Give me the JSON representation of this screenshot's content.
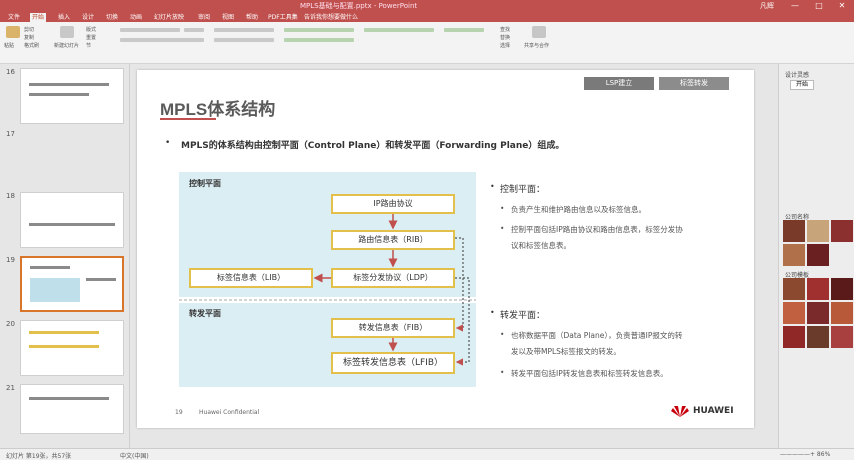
{
  "window": {
    "title": "MPLS基础与配置.pptx - PowerPoint",
    "user": "凡辉",
    "min": "—",
    "max": "□",
    "close": "✕"
  },
  "tabs": [
    "文件",
    "开始",
    "插入",
    "设计",
    "切换",
    "动画",
    "幻灯片放映",
    "审阅",
    "视图",
    "帮助",
    "PDF工具集",
    "告诉我你想要做什么"
  ],
  "ribbon": {
    "paste": "粘贴",
    "new_slide": "新建幻灯片",
    "find": "查找",
    "replace": "替换",
    "select": "选择",
    "present": "共享与合作",
    "cut": "剪切",
    "copy": "复制",
    "format": "格式刷",
    "layout": "版式",
    "reset": "重置",
    "section": "节"
  },
  "slides": [
    {
      "num": "16"
    },
    {
      "num": "17"
    },
    {
      "num": "18"
    },
    {
      "num": "19"
    },
    {
      "num": "20"
    },
    {
      "num": "21"
    }
  ],
  "slide": {
    "title": "MPLS体系结构",
    "nav_tabs": [
      "LSP建立",
      "标签转发"
    ],
    "bullet": "MPLS的体系结构由控制平面（Control Plane）和转发平面（Forwarding Plane）组成。",
    "diagram": {
      "control_label": "控制平面",
      "forward_label": "转发平面",
      "ip_routing": "IP路由协议",
      "rib": "路由信息表（RIB）",
      "ldp": "标签分发协议（LDP）",
      "lib": "标签信息表（LIB）",
      "fib": "转发信息表（FIB）",
      "lfib": "标签转发信息表（LFIB）"
    },
    "right": {
      "control_head": "控制平面：",
      "control_items": [
        "负责产生和维护路由信息以及标签信息。",
        "控制平面包括IP路由协议和路由信息表，标签分发协",
        "议和标签信息表。"
      ],
      "forward_head": "转发平面：",
      "forward_items": [
        "也称数据平面（Data Plane），负责普通IP报文的转",
        "发以及带MPLS标签报文的转发。",
        "转发平面包括IP转发信息表和标签转发信息表。"
      ]
    },
    "page_no": "19",
    "confidential": "Huawei Confidential",
    "brand": "HUAWEI"
  },
  "right_pane": {
    "title": "设计灵感",
    "label1": "公司名称",
    "label2": "公司模板",
    "button": "开始"
  },
  "status": {
    "slide_info": "幻灯片 第19张，共57张",
    "lang": "中文(中国)",
    "zoom": "—————+  86%"
  },
  "colors": {
    "accent": "#c0504d",
    "box_border": "#e3bf4b",
    "plane_bg": "#dbeef3"
  }
}
